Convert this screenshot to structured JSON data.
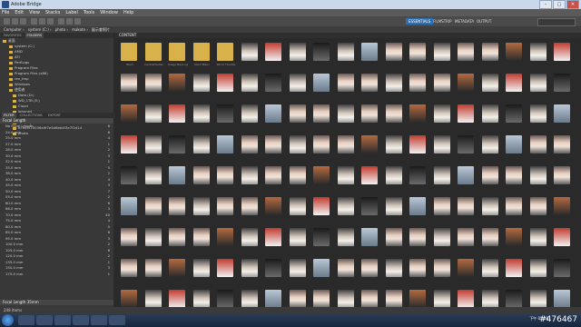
{
  "window": {
    "title": "Adobe Bridge"
  },
  "menu": [
    "File",
    "Edit",
    "View",
    "Stacks",
    "Label",
    "Tools",
    "Window",
    "Help"
  ],
  "workspaces": [
    "ESSENTIALS",
    "FILMSTRIP",
    "METADATA",
    "OUTPUT"
  ],
  "sort_label": "Sort by Filename",
  "path": [
    "Computer",
    "system (C:)",
    "photo",
    "makoto",
    "展示會照片"
  ],
  "left_tabs": [
    "FAVORITES",
    "FOLDERS"
  ],
  "folders": [
    "桌面",
    "system (C:)",
    "AMD",
    "ATI",
    "PerfLogs",
    "Program Files",
    "Program Files (x86)",
    "rev_tmp",
    "Windows",
    "使用者",
    "Data (D:)",
    "WD_1TB (E:)",
    "Cloud",
    "iphone4",
    "AA",
    "AA (R1)",
    "b7e6f570036a9f7e5d6eb4f3e7f2d14",
    "photo"
  ],
  "filter_tabs": [
    "FILTER",
    "COLLECTIONS",
    "EXPORT"
  ],
  "filter_title": "Focal Length",
  "filter_rows": [
    {
      "label": "No Focal Length",
      "count": "6"
    },
    {
      "label": "24.0 mm",
      "count": "8"
    },
    {
      "label": "25.0 mm",
      "count": "4"
    },
    {
      "label": "27.0 mm",
      "count": "1"
    },
    {
      "label": "28.0 mm",
      "count": "2"
    },
    {
      "label": "30.0 mm",
      "count": "3"
    },
    {
      "label": "32.0 mm",
      "count": "1"
    },
    {
      "label": "35.0 mm",
      "count": "5"
    },
    {
      "label": "38.0 mm",
      "count": "2"
    },
    {
      "label": "40.0 mm",
      "count": "4"
    },
    {
      "label": "45.0 mm",
      "count": "3"
    },
    {
      "label": "50.0 mm",
      "count": "7"
    },
    {
      "label": "55.0 mm",
      "count": "2"
    },
    {
      "label": "60.0 mm",
      "count": "6"
    },
    {
      "label": "66.0 mm",
      "count": "3"
    },
    {
      "label": "70.0 mm",
      "count": "40"
    },
    {
      "label": "75.0 mm",
      "count": "4"
    },
    {
      "label": "80.0 mm",
      "count": "5"
    },
    {
      "label": "85.0 mm",
      "count": "8"
    },
    {
      "label": "95.0 mm",
      "count": "3"
    },
    {
      "label": "100.0 mm",
      "count": "2"
    },
    {
      "label": "105.0 mm",
      "count": "6"
    },
    {
      "label": "120.0 mm",
      "count": "2"
    },
    {
      "label": "135.0 mm",
      "count": "1"
    },
    {
      "label": "150.0 mm",
      "count": "3"
    },
    {
      "label": "175.0 mm",
      "count": "1"
    }
  ],
  "filter_footer": "Focal Length 35mm",
  "content_tab": "CONTENT",
  "folder_thumbs": [
    "Bkoll",
    "CentralVantar",
    "Image Back-up",
    "Mont Blanc",
    "Wicro Thuntai"
  ],
  "status": "248 items",
  "clock": "下午 03:08",
  "watermark": "#476467"
}
